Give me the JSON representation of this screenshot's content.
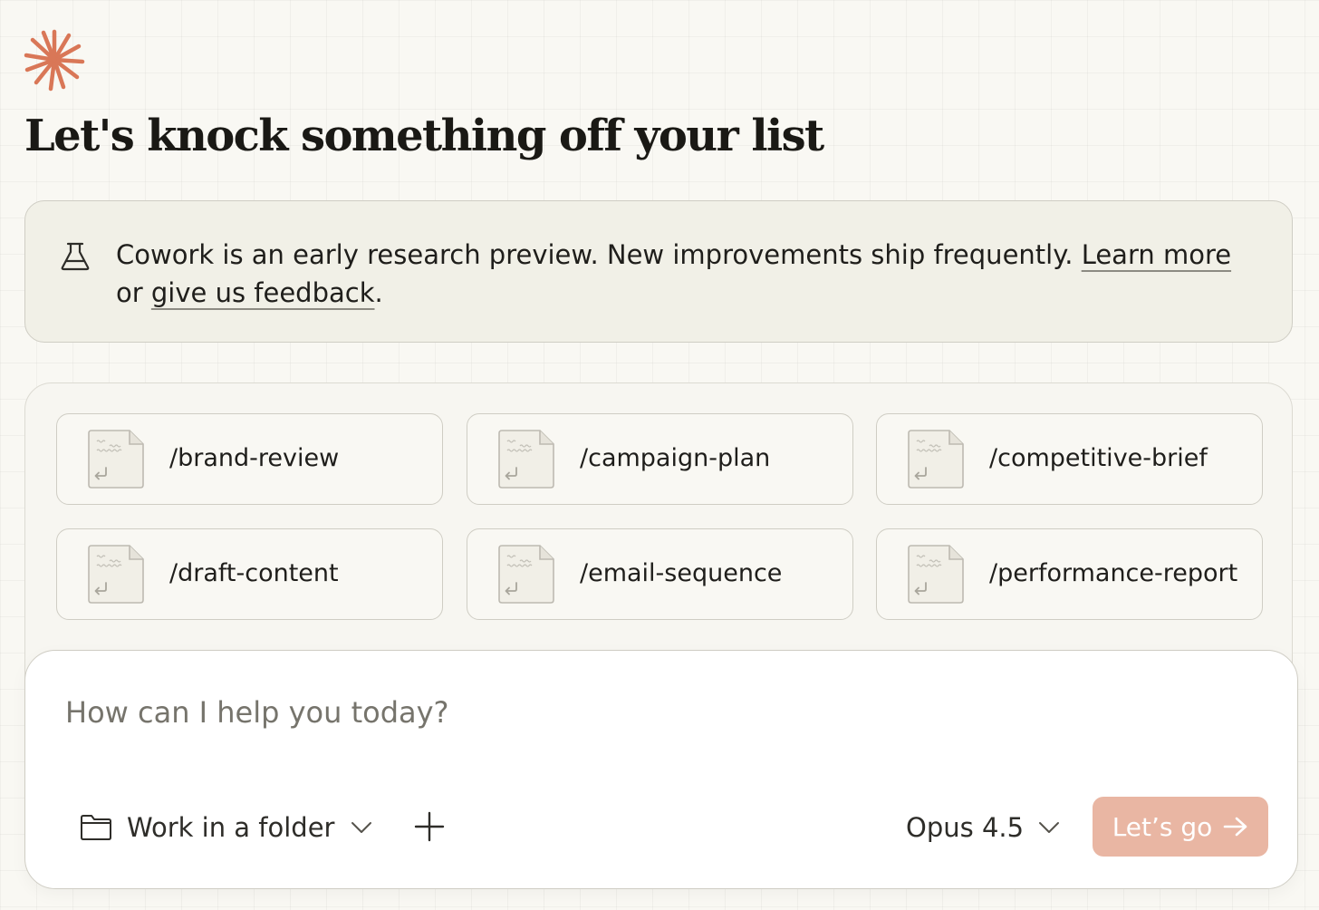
{
  "header": {
    "title": "Let's knock something off your list"
  },
  "notice": {
    "text": "Cowork is an early research preview. New improvements ship frequently.",
    "learn_more": "Learn more",
    "or": "or",
    "feedback": "give us feedback",
    "period": "."
  },
  "skills": [
    {
      "label": "/brand-review"
    },
    {
      "label": "/campaign-plan"
    },
    {
      "label": "/competitive-brief"
    },
    {
      "label": "/draft-content"
    },
    {
      "label": "/email-sequence"
    },
    {
      "label": "/performance-report"
    }
  ],
  "composer": {
    "placeholder": "How can I help you today?",
    "folder_label": "Work in a folder",
    "model_label": "Opus 4.5",
    "submit_label": "Let’s go"
  },
  "colors": {
    "accent": "#d97757",
    "submit_bg": "#e9b6a3",
    "background": "#f9f8f3"
  },
  "icons": {
    "logo": "sparkle-logo-icon",
    "notice": "flask-icon",
    "skill": "document-icon",
    "folder": "folder-icon",
    "add": "plus-icon",
    "dropdown": "chevron-down-icon",
    "submit": "arrow-right-icon"
  }
}
